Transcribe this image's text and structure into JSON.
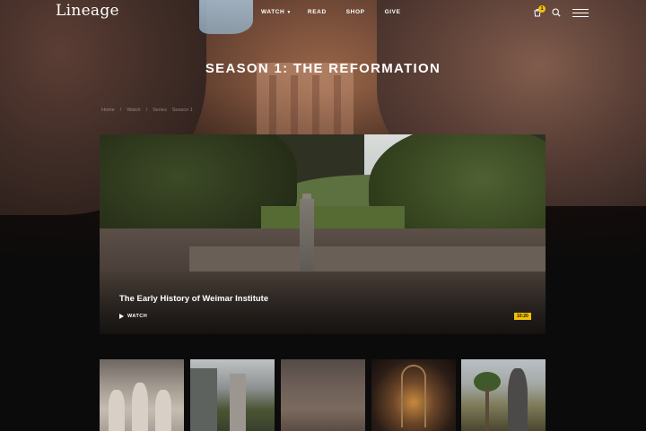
{
  "header": {
    "logo": "Lineage",
    "nav": [
      {
        "label": "WATCH",
        "has_dropdown": true
      },
      {
        "label": "READ"
      },
      {
        "label": "SHOP"
      },
      {
        "label": "GIVE"
      }
    ],
    "cart_count": "1"
  },
  "page": {
    "title": "SEASON 1: THE REFORMATION",
    "breadcrumb": [
      "Home",
      "/",
      "Watch",
      "/",
      "Series",
      "Season 1"
    ]
  },
  "feature": {
    "title": "The Early History of Weimar Institute",
    "watch_label": "WATCH",
    "duration": "10:20"
  },
  "colors": {
    "accent": "#f2c200",
    "background": "#0b0b0b"
  },
  "icons": [
    "cart-icon",
    "search-icon",
    "menu-icon",
    "play-icon"
  ]
}
